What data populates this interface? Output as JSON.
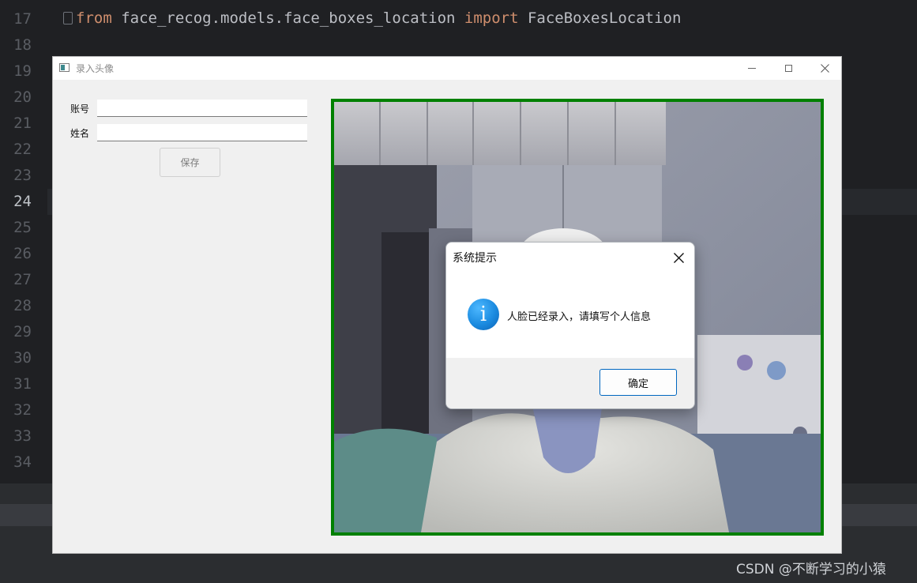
{
  "ide": {
    "line_numbers": [
      "17",
      "18",
      "19",
      "20",
      "21",
      "22",
      "23",
      "24",
      "25",
      "26",
      "27",
      "28",
      "29",
      "30",
      "31",
      "32",
      "33",
      "34"
    ],
    "active_line": "24",
    "code_line": {
      "kw_from": "from",
      "module": " face_recog.models.face_boxes_location ",
      "kw_import": "import",
      "name": " FaceBoxesLocation"
    }
  },
  "window": {
    "title": "录入头像",
    "account_label": "账号",
    "account_value": "",
    "name_label": "姓名",
    "name_value": "",
    "save_label": "保存"
  },
  "dialog": {
    "title": "系统提示",
    "message": "人脸已经录入，请填写个人信息",
    "ok_label": "确定"
  },
  "watermark": "CSDN @不断学习的小猿",
  "colors": {
    "camera_border": "#008000",
    "ok_border": "#0067c0",
    "keyword": "#cf8e6d"
  }
}
